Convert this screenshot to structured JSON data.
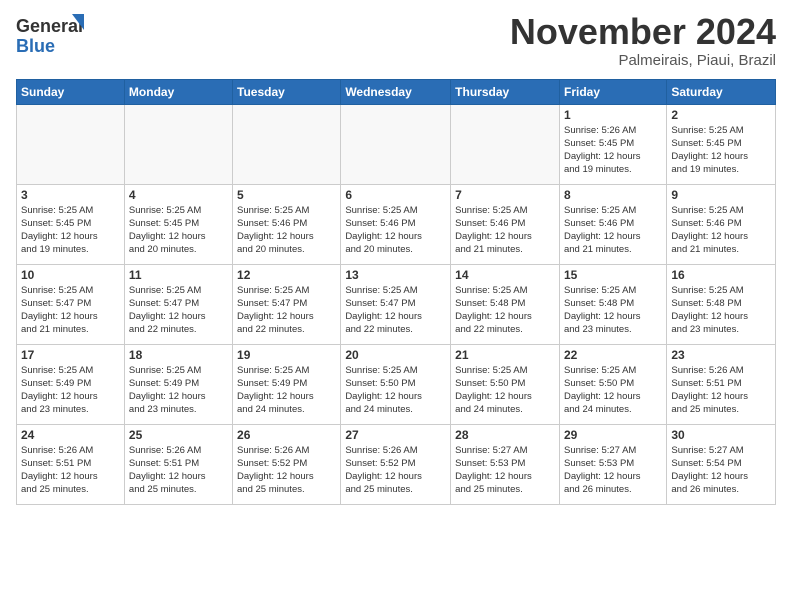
{
  "header": {
    "logo_general": "General",
    "logo_blue": "Blue",
    "month_title": "November 2024",
    "subtitle": "Palmeirais, Piaui, Brazil"
  },
  "weekdays": [
    "Sunday",
    "Monday",
    "Tuesday",
    "Wednesday",
    "Thursday",
    "Friday",
    "Saturday"
  ],
  "weeks": [
    [
      {
        "day": "",
        "info": ""
      },
      {
        "day": "",
        "info": ""
      },
      {
        "day": "",
        "info": ""
      },
      {
        "day": "",
        "info": ""
      },
      {
        "day": "",
        "info": ""
      },
      {
        "day": "1",
        "info": "Sunrise: 5:26 AM\nSunset: 5:45 PM\nDaylight: 12 hours\nand 19 minutes."
      },
      {
        "day": "2",
        "info": "Sunrise: 5:25 AM\nSunset: 5:45 PM\nDaylight: 12 hours\nand 19 minutes."
      }
    ],
    [
      {
        "day": "3",
        "info": "Sunrise: 5:25 AM\nSunset: 5:45 PM\nDaylight: 12 hours\nand 19 minutes."
      },
      {
        "day": "4",
        "info": "Sunrise: 5:25 AM\nSunset: 5:45 PM\nDaylight: 12 hours\nand 20 minutes."
      },
      {
        "day": "5",
        "info": "Sunrise: 5:25 AM\nSunset: 5:46 PM\nDaylight: 12 hours\nand 20 minutes."
      },
      {
        "day": "6",
        "info": "Sunrise: 5:25 AM\nSunset: 5:46 PM\nDaylight: 12 hours\nand 20 minutes."
      },
      {
        "day": "7",
        "info": "Sunrise: 5:25 AM\nSunset: 5:46 PM\nDaylight: 12 hours\nand 21 minutes."
      },
      {
        "day": "8",
        "info": "Sunrise: 5:25 AM\nSunset: 5:46 PM\nDaylight: 12 hours\nand 21 minutes."
      },
      {
        "day": "9",
        "info": "Sunrise: 5:25 AM\nSunset: 5:46 PM\nDaylight: 12 hours\nand 21 minutes."
      }
    ],
    [
      {
        "day": "10",
        "info": "Sunrise: 5:25 AM\nSunset: 5:47 PM\nDaylight: 12 hours\nand 21 minutes."
      },
      {
        "day": "11",
        "info": "Sunrise: 5:25 AM\nSunset: 5:47 PM\nDaylight: 12 hours\nand 22 minutes."
      },
      {
        "day": "12",
        "info": "Sunrise: 5:25 AM\nSunset: 5:47 PM\nDaylight: 12 hours\nand 22 minutes."
      },
      {
        "day": "13",
        "info": "Sunrise: 5:25 AM\nSunset: 5:47 PM\nDaylight: 12 hours\nand 22 minutes."
      },
      {
        "day": "14",
        "info": "Sunrise: 5:25 AM\nSunset: 5:48 PM\nDaylight: 12 hours\nand 22 minutes."
      },
      {
        "day": "15",
        "info": "Sunrise: 5:25 AM\nSunset: 5:48 PM\nDaylight: 12 hours\nand 23 minutes."
      },
      {
        "day": "16",
        "info": "Sunrise: 5:25 AM\nSunset: 5:48 PM\nDaylight: 12 hours\nand 23 minutes."
      }
    ],
    [
      {
        "day": "17",
        "info": "Sunrise: 5:25 AM\nSunset: 5:49 PM\nDaylight: 12 hours\nand 23 minutes."
      },
      {
        "day": "18",
        "info": "Sunrise: 5:25 AM\nSunset: 5:49 PM\nDaylight: 12 hours\nand 23 minutes."
      },
      {
        "day": "19",
        "info": "Sunrise: 5:25 AM\nSunset: 5:49 PM\nDaylight: 12 hours\nand 24 minutes."
      },
      {
        "day": "20",
        "info": "Sunrise: 5:25 AM\nSunset: 5:50 PM\nDaylight: 12 hours\nand 24 minutes."
      },
      {
        "day": "21",
        "info": "Sunrise: 5:25 AM\nSunset: 5:50 PM\nDaylight: 12 hours\nand 24 minutes."
      },
      {
        "day": "22",
        "info": "Sunrise: 5:25 AM\nSunset: 5:50 PM\nDaylight: 12 hours\nand 24 minutes."
      },
      {
        "day": "23",
        "info": "Sunrise: 5:26 AM\nSunset: 5:51 PM\nDaylight: 12 hours\nand 25 minutes."
      }
    ],
    [
      {
        "day": "24",
        "info": "Sunrise: 5:26 AM\nSunset: 5:51 PM\nDaylight: 12 hours\nand 25 minutes."
      },
      {
        "day": "25",
        "info": "Sunrise: 5:26 AM\nSunset: 5:51 PM\nDaylight: 12 hours\nand 25 minutes."
      },
      {
        "day": "26",
        "info": "Sunrise: 5:26 AM\nSunset: 5:52 PM\nDaylight: 12 hours\nand 25 minutes."
      },
      {
        "day": "27",
        "info": "Sunrise: 5:26 AM\nSunset: 5:52 PM\nDaylight: 12 hours\nand 25 minutes."
      },
      {
        "day": "28",
        "info": "Sunrise: 5:27 AM\nSunset: 5:53 PM\nDaylight: 12 hours\nand 25 minutes."
      },
      {
        "day": "29",
        "info": "Sunrise: 5:27 AM\nSunset: 5:53 PM\nDaylight: 12 hours\nand 26 minutes."
      },
      {
        "day": "30",
        "info": "Sunrise: 5:27 AM\nSunset: 5:54 PM\nDaylight: 12 hours\nand 26 minutes."
      }
    ]
  ]
}
